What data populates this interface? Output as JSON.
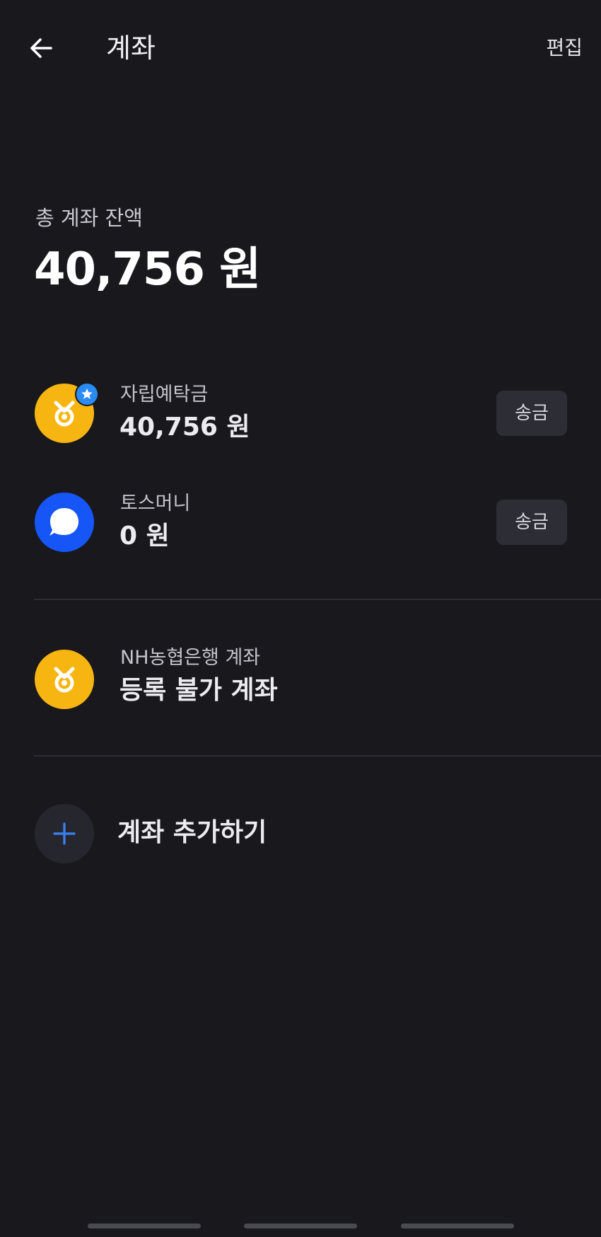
{
  "header": {
    "title": "계좌",
    "edit_label": "편집"
  },
  "summary": {
    "label": "총 계좌 잔액",
    "value": "40,756 원"
  },
  "accounts": [
    {
      "name": "자립예탁금",
      "value": "40,756 원",
      "action_label": "송금",
      "logo": "nh-bank-logo",
      "primary": true
    },
    {
      "name": "토스머니",
      "value": "0 원",
      "action_label": "송금",
      "logo": "toss-logo"
    }
  ],
  "unregistered": {
    "name": "NH농협은행 계좌",
    "value": "등록 불가 계좌",
    "logo": "nh-bank-logo"
  },
  "add_account": {
    "label": "계좌 추가하기",
    "icon": "plus-icon"
  },
  "colors": {
    "background": "#18181d",
    "nh_yellow": "#f7b512",
    "toss_blue": "#1655f6",
    "accent_blue": "#3b82f6"
  }
}
